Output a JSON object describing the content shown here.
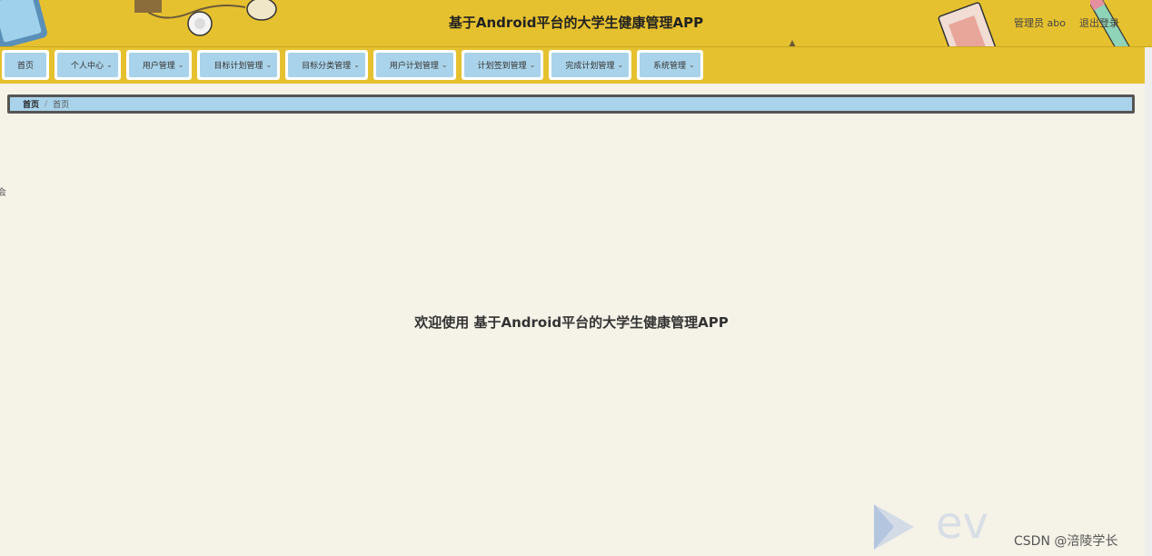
{
  "header": {
    "title": "基于Android平台的大学生健康管理APP",
    "user": "管理员 abo",
    "logout": "退出登录"
  },
  "nav": {
    "items": [
      {
        "label": "首页",
        "has_dropdown": false
      },
      {
        "label": "个人中心",
        "has_dropdown": true
      },
      {
        "label": "用户管理",
        "has_dropdown": true
      },
      {
        "label": "目标计划管理",
        "has_dropdown": true
      },
      {
        "label": "目标分类管理",
        "has_dropdown": true
      },
      {
        "label": "用户计划管理",
        "has_dropdown": true
      },
      {
        "label": "计划签到管理",
        "has_dropdown": true
      },
      {
        "label": "完成计划管理",
        "has_dropdown": true
      },
      {
        "label": "系统管理",
        "has_dropdown": true
      }
    ],
    "chevron": "⌄"
  },
  "breadcrumb": {
    "current": "首页",
    "separator": "/",
    "last": "首页"
  },
  "main": {
    "welcome": "欢迎使用 基于Android平台的大学生健康管理APP",
    "edge_char": "会"
  },
  "watermark": {
    "ev_text": "ev",
    "csdn": "CSDN @涪陵学长"
  },
  "colors": {
    "header_bg": "#e6c12f",
    "nav_item_bg": "#a9d3ea",
    "page_bg": "#f5f2e7"
  }
}
